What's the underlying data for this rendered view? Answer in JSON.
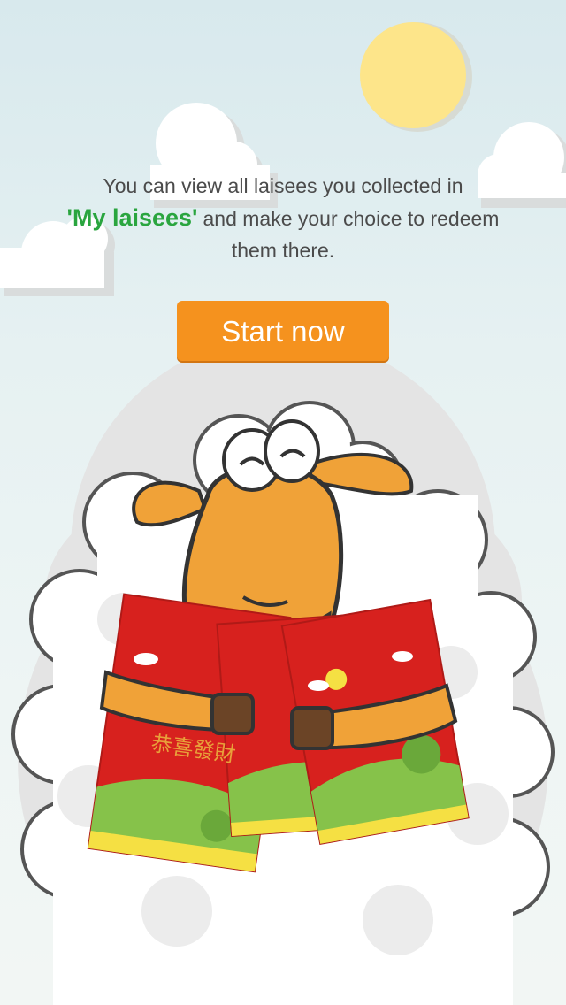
{
  "intro": {
    "line1": "You can view all laisees you collected in",
    "highlight": "'My laisees'",
    "line2_rest": "and make your choice to redeem",
    "line3": "them there."
  },
  "cta": {
    "label": "Start now"
  },
  "envelopes": {
    "text": "恭喜發財"
  },
  "colors": {
    "highlight": "#2aa53f",
    "button": "#f5921e",
    "envelope": "#d7211e",
    "sun": "#fde58a"
  },
  "icons": [
    "sun-icon",
    "cloud-icon",
    "sheep-mascot",
    "red-envelope"
  ]
}
